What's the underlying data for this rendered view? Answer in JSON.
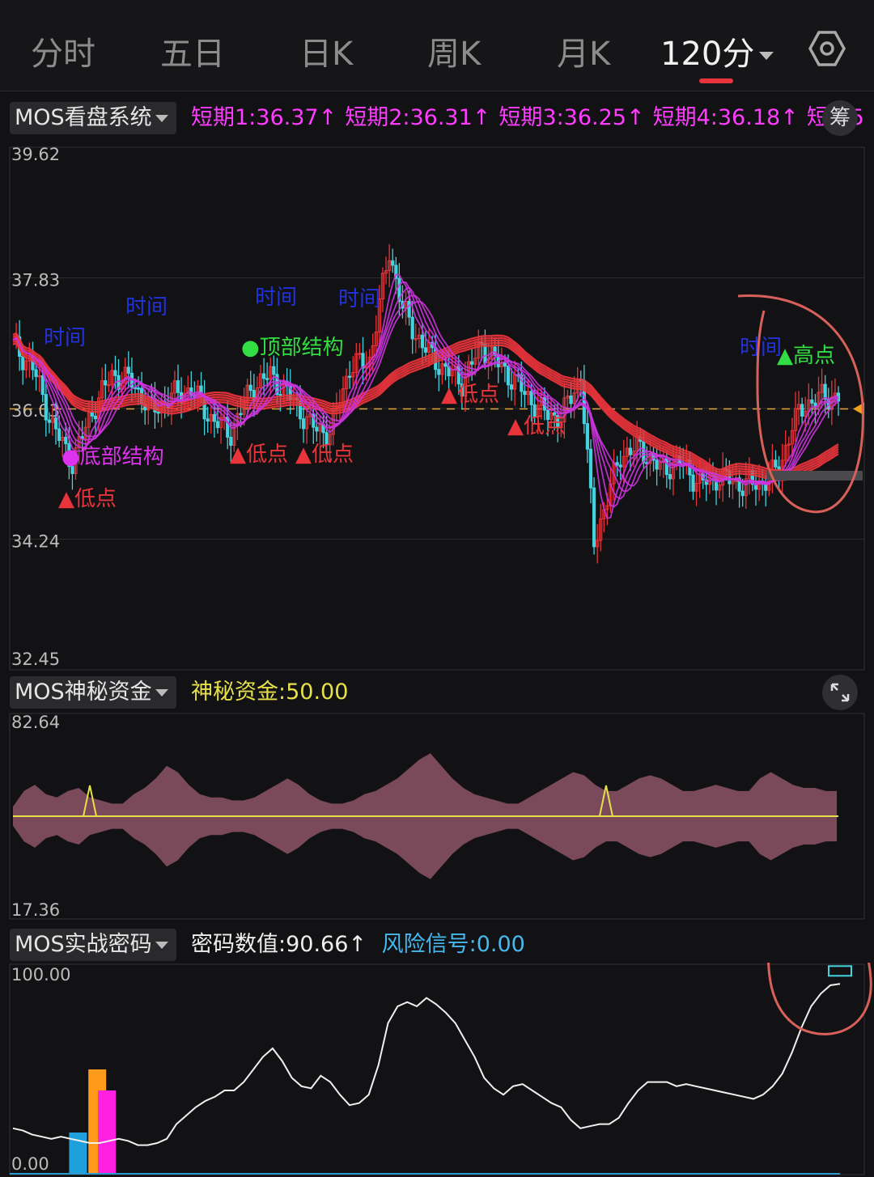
{
  "tabs": [
    {
      "label": "分时"
    },
    {
      "label": "五日"
    },
    {
      "label": "日K"
    },
    {
      "label": "周K"
    },
    {
      "label": "月K"
    },
    {
      "label": "120分"
    }
  ],
  "active_tab": 5,
  "colors": {
    "up": "#e8343a",
    "down": "#45d2df",
    "ma_fast": "#cc33dd",
    "ma_slow": "#e8343a",
    "mos_fill": "#7a4a5a",
    "mos_line": "#e6e04a",
    "signal_blue": "#1fa0dc",
    "signal_orange": "#ff9a1a",
    "signal_magenta": "#ff20e0",
    "accent_circle": "#d8605a"
  },
  "panel_main": {
    "selector": "MOS看盘系统",
    "values": [
      {
        "label": "短期1:36.37↑",
        "color": "#ff3cff"
      },
      {
        "label": "短期2:36.31↑",
        "color": "#ff3cff"
      },
      {
        "label": "短期3:36.25↑",
        "color": "#ff3cff"
      },
      {
        "label": "短期4:36.18↑",
        "color": "#ff3cff"
      },
      {
        "label": "短期5",
        "color": "#ff3cff"
      }
    ],
    "chip_label": "筹",
    "annotations": {
      "time": "时间",
      "low": "▲低点",
      "top": "●顶部结构",
      "bottom": "●底部结构",
      "high": "▲高点"
    }
  },
  "panel_mid": {
    "selector": "MOS神秘资金",
    "value_label": "神秘资金:50.00"
  },
  "panel_bottom": {
    "selector": "MOS实战密码",
    "value_label": "密码数值:90.66↑",
    "risk_label": "风险信号:0.00"
  },
  "chart_data": [
    {
      "type": "candlestick",
      "y_ticks": [
        "39.62",
        "37.83",
        "36.03",
        "34.24",
        "32.45"
      ],
      "ylim": [
        32.45,
        39.62
      ],
      "reference_price": 36.03,
      "series": [
        {
          "name": "短期1",
          "last": 36.37
        },
        {
          "name": "短期2",
          "last": 36.31
        },
        {
          "name": "短期3",
          "last": 36.25
        },
        {
          "name": "短期4",
          "last": 36.18
        }
      ]
    },
    {
      "type": "area",
      "y_ticks": [
        "82.64",
        "17.36"
      ],
      "ylim": [
        17.36,
        82.64
      ],
      "baseline": 50.0,
      "envelope_half_width": [
        3,
        8,
        10,
        7,
        6,
        8,
        9,
        6,
        5,
        4,
        4,
        7,
        9,
        12,
        16,
        14,
        10,
        7,
        6,
        6,
        5,
        5,
        6,
        8,
        10,
        12,
        10,
        7,
        5,
        4,
        4,
        5,
        7,
        8,
        10,
        12,
        15,
        18,
        20,
        16,
        12,
        9,
        7,
        6,
        5,
        4,
        4,
        6,
        8,
        10,
        12,
        14,
        13,
        10,
        8,
        8,
        10,
        12,
        13,
        12,
        10,
        8,
        8,
        9,
        10,
        9,
        8,
        8,
        12,
        14,
        12,
        10,
        9,
        9,
        8,
        8
      ],
      "spikes_at": [
        7,
        54
      ]
    },
    {
      "type": "line",
      "y_ticks": [
        "100.00",
        "0.00"
      ],
      "ylim": [
        0,
        100
      ],
      "values": [
        22,
        21,
        19,
        18,
        17,
        18,
        17,
        16,
        15,
        15,
        16,
        17,
        16,
        14,
        14,
        15,
        17,
        24,
        28,
        32,
        35,
        37,
        40,
        40,
        44,
        50,
        56,
        60,
        54,
        46,
        42,
        41,
        47,
        44,
        38,
        33,
        34,
        38,
        52,
        72,
        80,
        82,
        80,
        84,
        81,
        77,
        72,
        64,
        56,
        46,
        41,
        38,
        42,
        43,
        40,
        37,
        34,
        32,
        26,
        22,
        23,
        24,
        24,
        27,
        34,
        40,
        44,
        44,
        44,
        42,
        43,
        42,
        41,
        40,
        39,
        38,
        37,
        36,
        38,
        42,
        48,
        58,
        70,
        80,
        86,
        90,
        90.66
      ],
      "bars": [
        {
          "x_index": 5,
          "value": 20,
          "color": "blue"
        },
        {
          "x_index": 7,
          "value": 50,
          "color": "orange"
        },
        {
          "x_index": 8,
          "value": 40,
          "color": "magenta"
        }
      ]
    }
  ]
}
